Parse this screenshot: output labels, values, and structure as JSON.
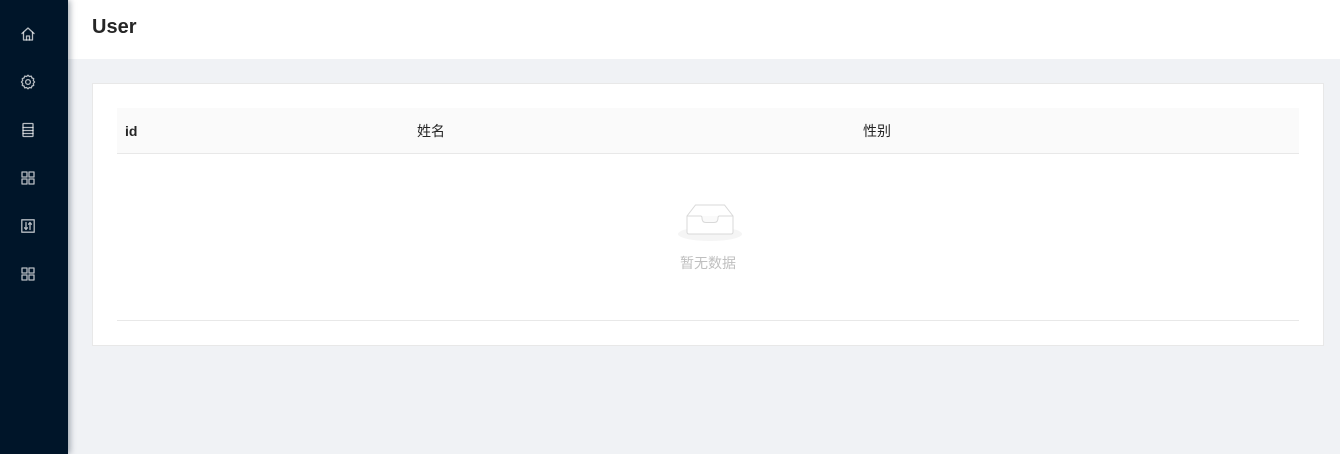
{
  "header": {
    "title": "User"
  },
  "sidebar": {
    "items": [
      {
        "icon": "home-icon"
      },
      {
        "icon": "gear-icon"
      },
      {
        "icon": "document-list-icon"
      },
      {
        "icon": "grid-icon"
      },
      {
        "icon": "sliders-icon"
      },
      {
        "icon": "grid-icon"
      }
    ]
  },
  "table": {
    "columns": [
      "id",
      "姓名",
      "性别"
    ],
    "rows": [],
    "empty_text": "暂无数据"
  }
}
